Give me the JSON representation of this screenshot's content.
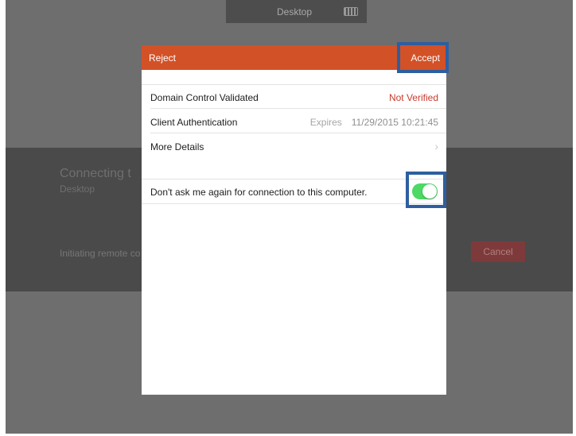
{
  "topbar": {
    "title": "Desktop",
    "keyboard_icon": "keyboard-icon"
  },
  "background": {
    "connecting_title": "Connecting t",
    "connecting_subtitle": "Desktop",
    "status_text": "Initiating remote co",
    "cancel_label": "Cancel"
  },
  "dialog": {
    "reject_label": "Reject",
    "accept_label": "Accept",
    "rows": [
      {
        "label": "Domain Control Validated",
        "value": "Not Verified"
      },
      {
        "label": "Client Authentication",
        "value_label": "Expires",
        "value": "11/29/2015 10:21:45"
      },
      {
        "label": "More Details",
        "chevron": "›"
      }
    ],
    "toggle": {
      "label": "Don't ask me again for connection to this computer.",
      "on": true
    }
  },
  "colors": {
    "header": "#d35127",
    "not_verified": "#c9392b",
    "toggle_on": "#4cd964",
    "highlight_border": "#2d5fa0"
  }
}
